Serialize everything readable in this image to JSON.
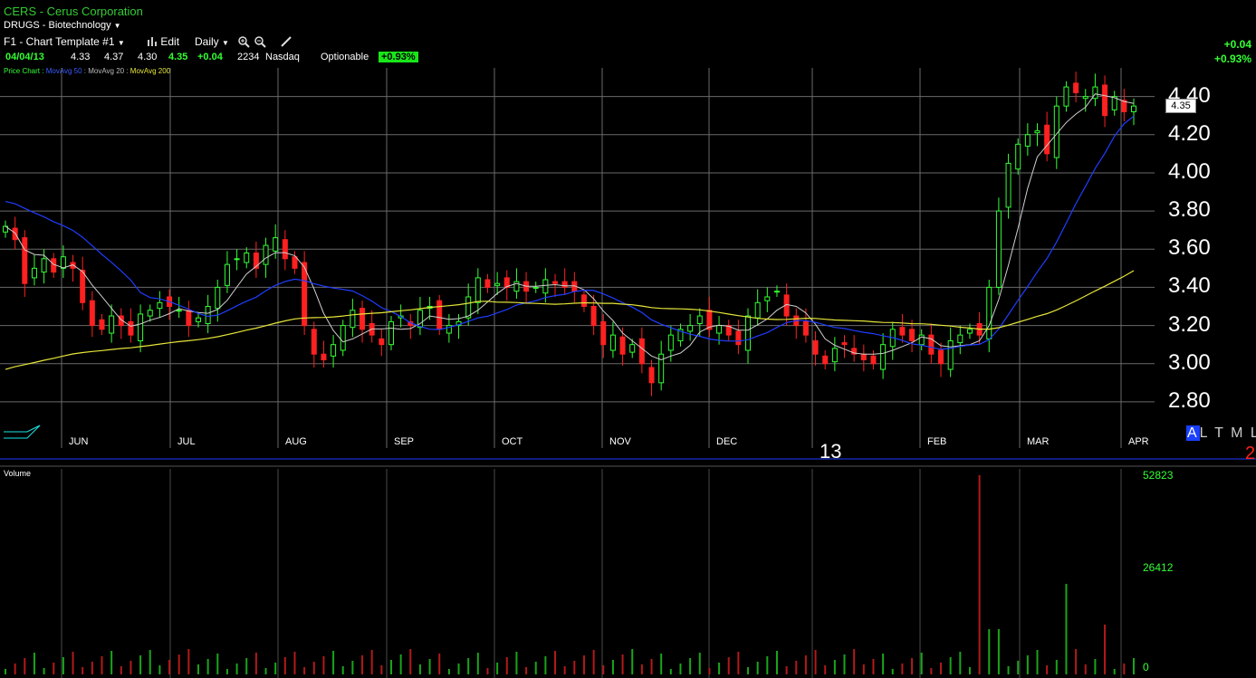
{
  "header": {
    "symbol": "CERS",
    "company": "Cerus Corporation",
    "symbol_line": "CERS - Cerus Corporation",
    "industry": "DRUGS - Biotechnology",
    "industry_dropdown_icon": "triangle-down-icon"
  },
  "toolbar": {
    "template": "F1 - Chart Template #1",
    "edit": "Edit",
    "period": "Daily",
    "icons": [
      "bar-chart-icon",
      "zoom-in-icon",
      "zoom-out-icon",
      "draw-line-icon"
    ]
  },
  "quote": {
    "date": "04/04/13",
    "open": "4.33",
    "high": "4.37",
    "low": "4.30",
    "last": "4.35",
    "change": "+0.04",
    "volume": "2234",
    "exchange": "Nasdaq",
    "optionable": "Optionable",
    "pct": "+0.93%"
  },
  "change_box": {
    "change": "+0.04",
    "pct": "+0.93%"
  },
  "legend": {
    "price_chart": "Price Chart :",
    "ma50": "MovAvg 50",
    "ma20": "MovAvg 20",
    "ma200": "MovAvg 200"
  },
  "colors": {
    "up": "#33ff33",
    "down": "#ff2020",
    "ma50": "#1f3dff",
    "ma20": "#cfcfcf",
    "ma200": "#e6e63a",
    "grid": "#6a6a6a"
  },
  "last_price_tag": "4.35",
  "range_buttons": [
    "A",
    "L",
    "T",
    "M",
    "L"
  ],
  "year_label": "13",
  "red_number": "2",
  "volume_panel": {
    "label": "Volume",
    "ticks": [
      "52823",
      "26412",
      "0"
    ]
  },
  "chart_data": {
    "type": "candlestick",
    "y_ticks": [
      "4.40",
      "4.20",
      "4.00",
      "3.80",
      "3.60",
      "3.40",
      "3.20",
      "3.00",
      "2.80"
    ],
    "ylim": [
      2.7,
      4.55
    ],
    "months": [
      "JUN",
      "JUL",
      "AUG",
      "SEP",
      "OCT",
      "NOV",
      "DEC",
      "FEB",
      "MAR",
      "APR"
    ],
    "closes": [
      3.72,
      3.65,
      3.42,
      3.5,
      3.55,
      3.48,
      3.56,
      3.5,
      3.32,
      3.2,
      3.18,
      3.25,
      3.2,
      3.15,
      3.26,
      3.28,
      3.32,
      3.3,
      3.28,
      3.2,
      3.24,
      3.3,
      3.4,
      3.52,
      3.55,
      3.58,
      3.5,
      3.62,
      3.66,
      3.55,
      3.5,
      3.2,
      3.05,
      3.02,
      3.1,
      3.2,
      3.28,
      3.18,
      3.15,
      3.1,
      3.22,
      3.25,
      3.2,
      3.28,
      3.3,
      3.18,
      3.2,
      3.22,
      3.35,
      3.45,
      3.4,
      3.42,
      3.4,
      3.43,
      3.38,
      3.4,
      3.44,
      3.42,
      3.4,
      3.38,
      3.3,
      3.2,
      3.1,
      3.15,
      3.05,
      3.1,
      3.0,
      2.9,
      3.05,
      3.15,
      3.18,
      3.2,
      3.25,
      3.18,
      3.2,
      3.15,
      3.1,
      3.25,
      3.32,
      3.35,
      3.38,
      3.25,
      3.2,
      3.15,
      3.05,
      3.0,
      3.08,
      3.1,
      3.05,
      3.02,
      3.0,
      3.1,
      3.18,
      3.15,
      3.12,
      3.15,
      3.05,
      3.0,
      3.12,
      3.15,
      3.18,
      3.15,
      3.4,
      3.8,
      4.05,
      4.15,
      4.2,
      4.22,
      4.1,
      4.35,
      4.45,
      4.42,
      4.4,
      4.45,
      4.3,
      4.4,
      4.32,
      4.35
    ]
  }
}
